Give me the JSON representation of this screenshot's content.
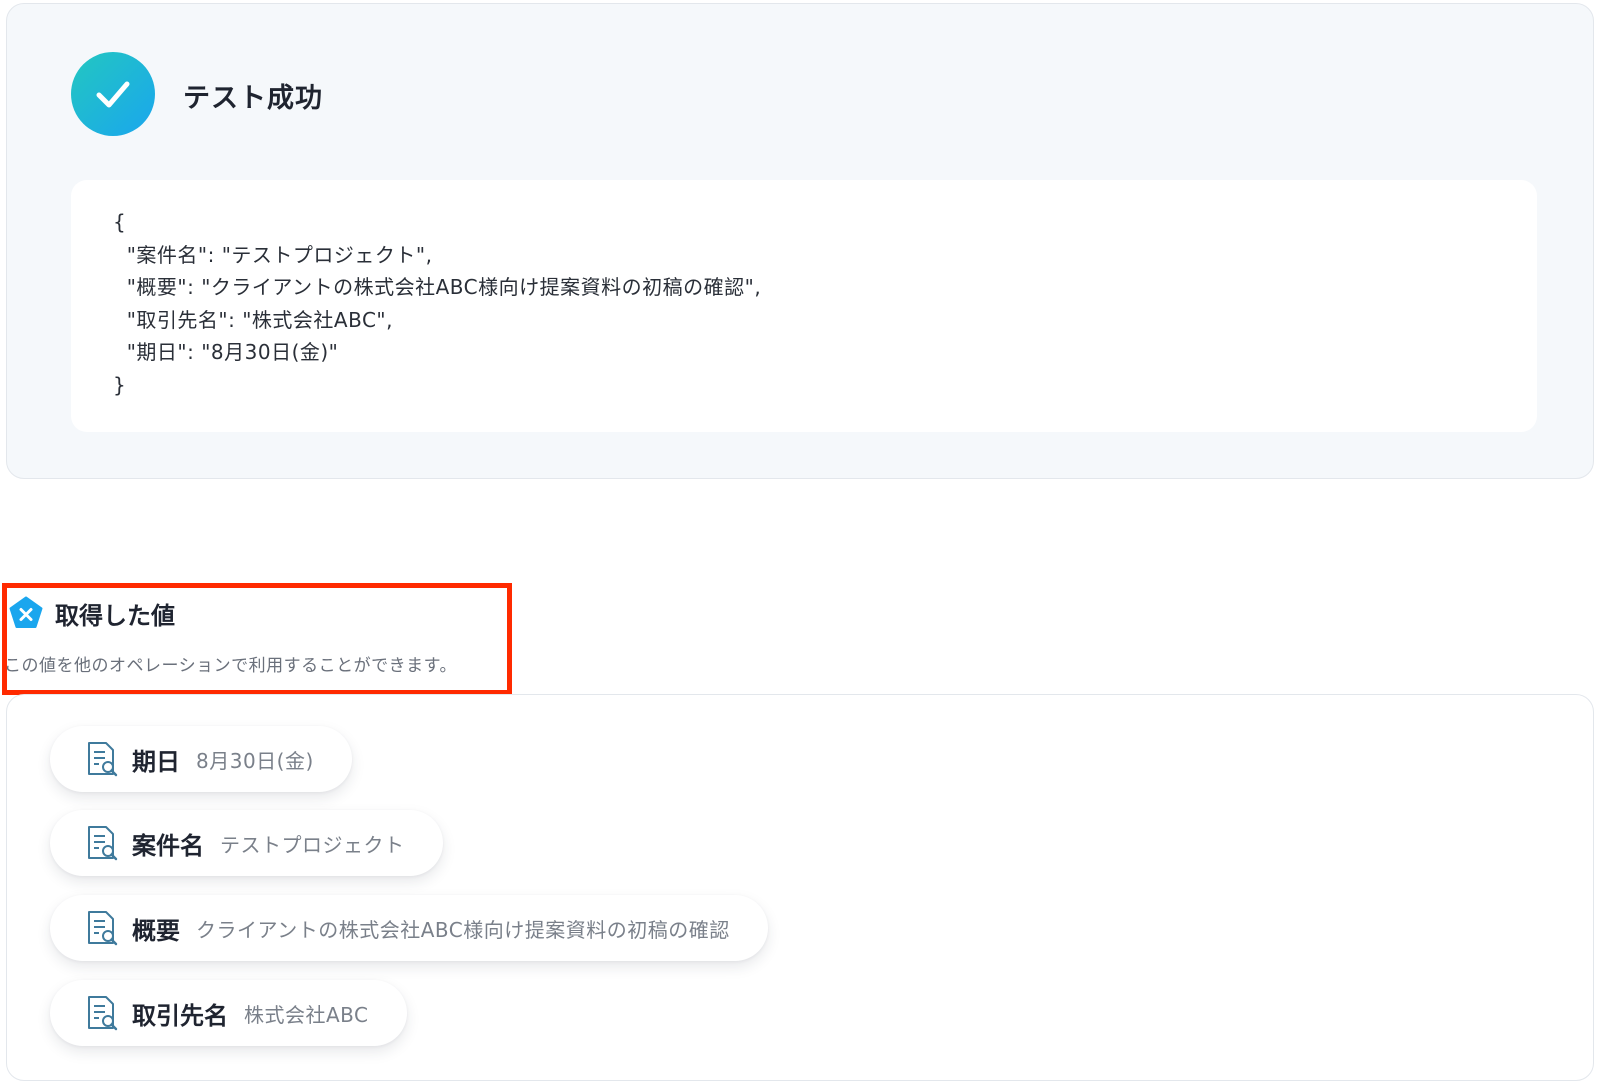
{
  "test_result": {
    "title": "テスト成功",
    "json_lines": [
      "{",
      "  \"案件名\": \"テストプロジェクト\",",
      "  \"概要\": \"クライアントの株式会社ABC様向け提案資料の初稿の確認\",",
      "  \"取引先名\": \"株式会社ABC\",",
      "  \"期日\": \"8月30日(金)\"",
      "}"
    ]
  },
  "retrieved_values": {
    "title": "取得した値",
    "description": "この値を他のオペレーションで利用することができます。",
    "items": [
      {
        "label": "期日",
        "value": "8月30日(金)"
      },
      {
        "label": "案件名",
        "value": "テストプロジェクト"
      },
      {
        "label": "概要",
        "value": "クライアントの株式会社ABC様向け提案資料の初稿の確認"
      },
      {
        "label": "取引先名",
        "value": "株式会社ABC"
      }
    ]
  },
  "colors": {
    "success_gradient_start": "#23c7c0",
    "success_gradient_end": "#1aa6ee",
    "highlight_border": "#ff2a00",
    "section_icon": "#1aa6ee"
  },
  "icons": {
    "success": "checkmark-icon",
    "section": "variable-icon",
    "item": "document-search-icon"
  }
}
